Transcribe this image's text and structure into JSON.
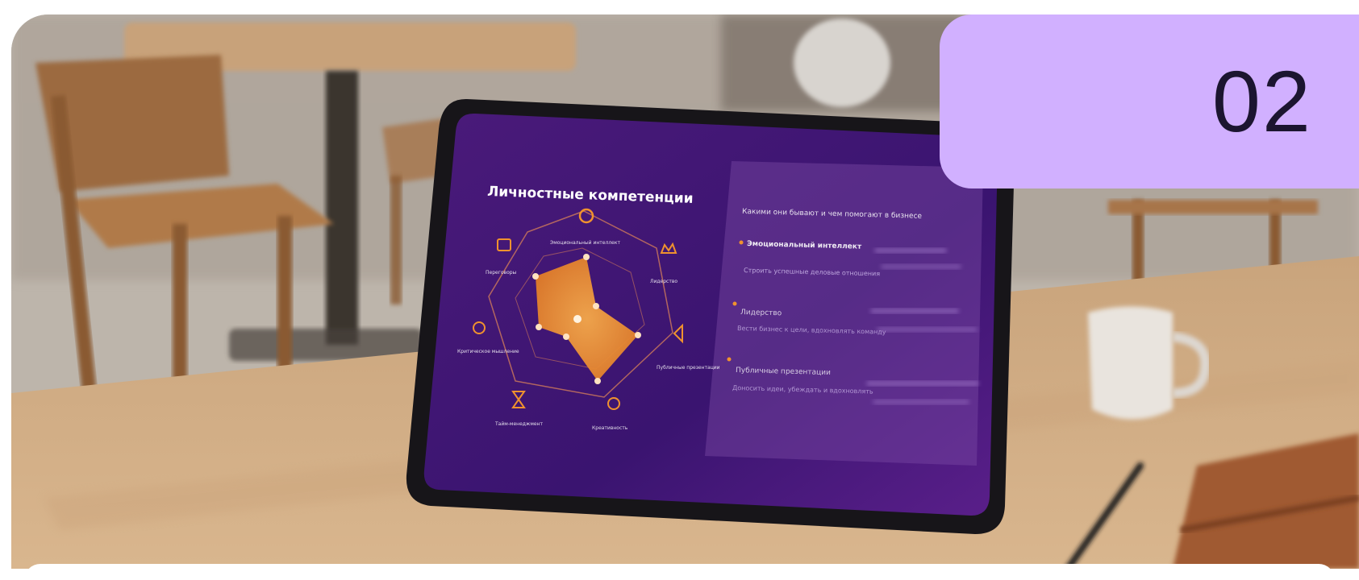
{
  "badge": {
    "number": "02"
  },
  "tablet_slide": {
    "title": "Личностные компетенции",
    "panel_heading": "Какими они бывают и чем помогают в бизнесе",
    "radar_labels": {
      "top": "Эмоциональный интеллект",
      "top_right": "Лидерство",
      "right": "Публичные презентации",
      "bottom_right": "Креативность",
      "bottom_left": "Тайм-менеджмент",
      "left": "Критическое мышление",
      "top_left": "Переговоры"
    },
    "bullets": [
      {
        "title": "Эмоциональный интеллект",
        "desc": "Строить успешные деловые отношения"
      },
      {
        "title": "Лидерство",
        "desc": "Вести бизнес к цели, вдохновлять команду"
      },
      {
        "title": "Публичные презентации",
        "desc": "Доносить идеи, убеждать и вдохновлять"
      }
    ]
  },
  "colors": {
    "badge_bg": "#d1b0ff",
    "badge_text": "#1c1530",
    "slide_bg": "#3a1470",
    "radar_fill": "#f0922e"
  }
}
